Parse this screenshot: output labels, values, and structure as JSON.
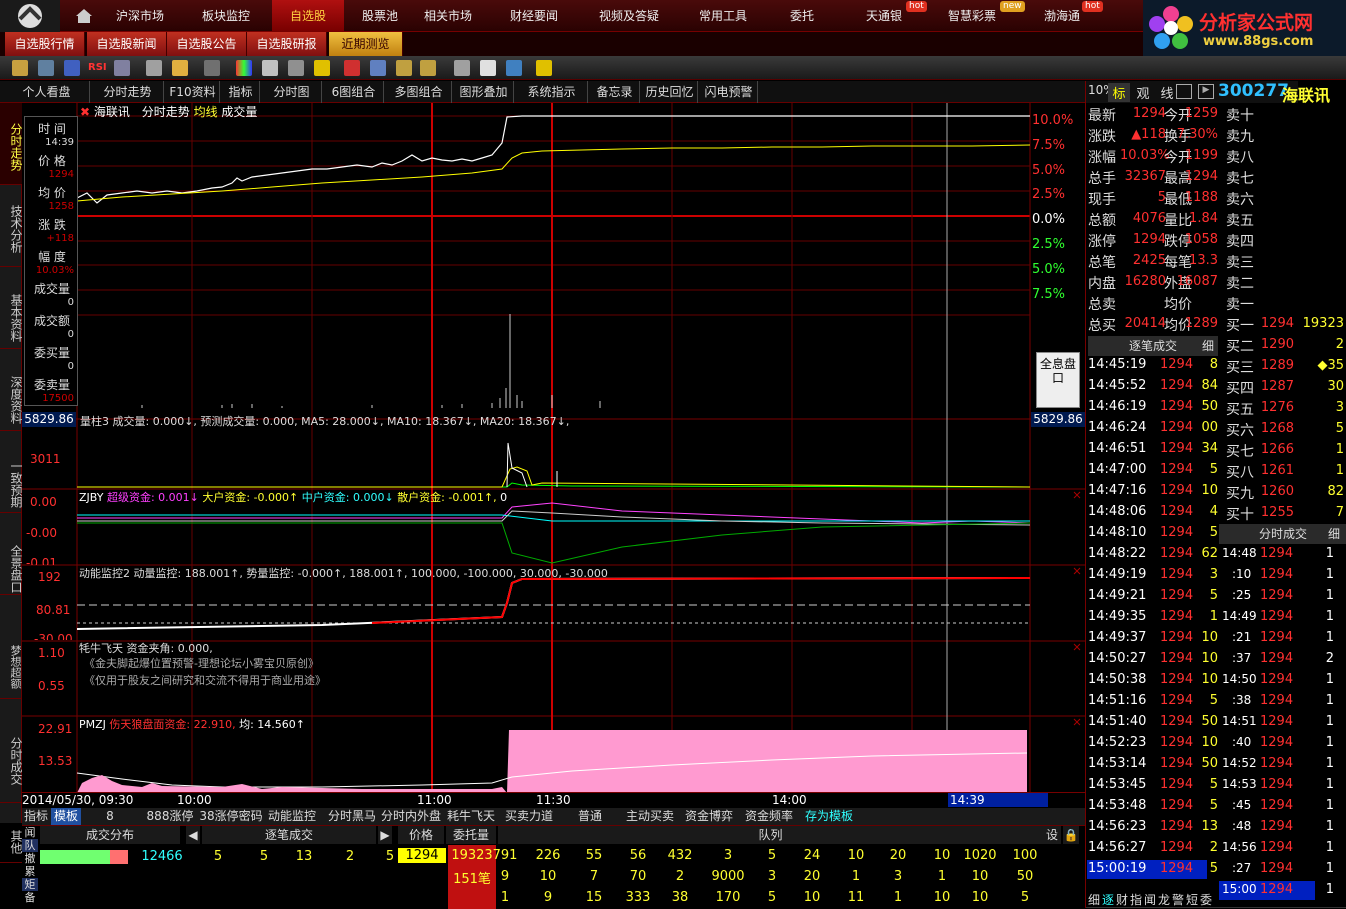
{
  "topnav": {
    "items": [
      "沪深市场",
      "板块监控",
      "自选股",
      "股票池",
      "相关市场",
      "财经要闻",
      "视频及答疑",
      "常用工具",
      "委托",
      "天通银",
      "智慧彩票",
      "渤海通"
    ],
    "badges": [
      "hot",
      "new",
      "hot"
    ]
  },
  "brand": {
    "line1": "分析家公式网",
    "line2": "www.88gs.com"
  },
  "subnav": [
    "自选股行情",
    "自选股新闻",
    "自选股公告",
    "自选股研报",
    "近期测览"
  ],
  "funcbar": [
    "个人看盘",
    "分时走势",
    "F10资料",
    "指标",
    "分时图",
    "6图组合",
    "多图组合",
    "图形叠加",
    "系统指示",
    "备忘录",
    "历史回忆",
    "闪电预警"
  ],
  "leftvtabs": [
    "分时走势",
    "技术分析",
    "基本资料",
    "深度资料",
    "一致预期",
    "全景盘口",
    "梦想超额",
    "分时成交",
    "其他"
  ],
  "chart_header": {
    "stock": "海联讯",
    "mode": "分时走势",
    "avg": "均线",
    "vol": "成交量"
  },
  "infobox": [
    {
      "label": "时 间",
      "value": "14:39"
    },
    {
      "label": "价 格",
      "value": "1294"
    },
    {
      "label": "均 价",
      "value": "1258"
    },
    {
      "label": "涨 跌",
      "value": "+118"
    },
    {
      "label": "幅 度",
      "value": "10.03%"
    },
    {
      "label": "成交量",
      "value": "0"
    },
    {
      "label": "成交额",
      "value": "0"
    },
    {
      "label": "委买量",
      "value": "0"
    },
    {
      "label": "委卖量",
      "value": "17500"
    }
  ],
  "pct_axis": [
    "10.0%",
    "7.5%",
    "5.0%",
    "2.5%",
    "0.0%",
    "2.5%",
    "5.0%",
    "7.5%"
  ],
  "full_info_btn": "全息盘口",
  "vol_panel": {
    "left_val": "5829.86",
    "right_val": "5829.86",
    "legend": "量柱3 成交量: 0.000↓, 预测成交量: 0.000, MA5: 28.000↓, MA10: 18.367↓, MA20: 18.367↓,",
    "ytick": "3011"
  },
  "zjby_panel": {
    "ticks": [
      "0.00",
      "-0.00",
      "-0.01"
    ],
    "legend_name": "ZJBY",
    "items": [
      "超级资金: 0.001↓",
      "大户资金: -0.000↑",
      "中户资金: 0.000↓",
      "散户资金: -0.001↑,",
      "0"
    ]
  },
  "dnjk_panel": {
    "ticks": [
      "192",
      "80.81",
      "-30.00"
    ],
    "legend": "动能监控2 动量监控: 188.001↑, 势量监控: -0.000↑, 188.001↑, 100.000, -100.000, 30.000, -30.000"
  },
  "nfft_panel": {
    "ticks": [
      "1.10",
      "0.55"
    ],
    "legend": "牦牛飞天 资金夹角: 0.000,",
    "line1": "《金夫脚起爆位置预警-理想论坛小雾宝贝原创》",
    "line2": "《仅用于股友之间研究和交流不得用于商业用途》"
  },
  "pmzj_panel": {
    "ticks": [
      "22.91",
      "13.53"
    ],
    "legend_name": "PMZJ",
    "legend_a": "伤天狼盘面资金: 22.910,",
    "legend_b": "均: 14.560↑"
  },
  "xaxis": {
    "date": "2014/05/30, 09:30",
    "ticks": [
      "10:00",
      "11:00",
      "11:30",
      "14:00"
    ],
    "cursor": "14:39"
  },
  "btabs": [
    "指标",
    "模板",
    "8",
    "888涨停",
    "38涨停密码",
    "动能监控",
    "分时黑马",
    "分时内外盘",
    "耗牛飞天",
    "买卖力道",
    "普通",
    "主动买卖",
    "资金博弈",
    "资金频率",
    "存为模板"
  ],
  "bottom": {
    "heads": [
      "成交分布",
      "逐笔成交",
      "价格",
      "委托量",
      "队列",
      "设"
    ],
    "left_tabs": [
      "闻",
      "队",
      "撤",
      "累",
      "矩",
      "备"
    ],
    "total": "12466",
    "zb": [
      "5",
      "5",
      "13",
      "2",
      "5"
    ],
    "price": "1294",
    "wt": "19323",
    "wt2": "151笔",
    "queue": [
      [
        "791",
        "226",
        "55",
        "56",
        "432",
        "3",
        "5",
        "24",
        "10",
        "20",
        "10",
        "1020",
        "100"
      ],
      [
        "9",
        "10",
        "7",
        "70",
        "2",
        "9000",
        "3",
        "20",
        "1",
        "3",
        "1",
        "10",
        "50"
      ],
      [
        "1",
        "9",
        "15",
        "333",
        "38",
        "170",
        "5",
        "10",
        "11",
        "1",
        "10",
        "10",
        "5"
      ]
    ]
  },
  "right": {
    "ratio_tabs": [
      "10%",
      "标",
      "观",
      "线"
    ],
    "code": "300277",
    "name": "海联讯",
    "quote": [
      {
        "l": "最新",
        "v": "1294",
        "l2": "今开",
        "v2": "1259"
      },
      {
        "l": "涨跌",
        "v": "▲118",
        "l2": "换手",
        "v2": "7.30%"
      },
      {
        "l": "涨幅",
        "v": "10.03%",
        "l2": "今开",
        "v2": "1199"
      },
      {
        "l": "总手",
        "v": "32367",
        "l2": "最高",
        "v2": "1294"
      },
      {
        "l": "现手",
        "v": "5",
        "l2": "最低",
        "v2": "1188"
      },
      {
        "l": "总额",
        "v": "4076",
        "l2": "量比",
        "v2": "1.84"
      },
      {
        "l": "涨停",
        "v": "1294",
        "l2": "跌停",
        "v2": "1058"
      },
      {
        "l": "总笔",
        "v": "2425",
        "l2": "每笔",
        "v2": "13.3"
      },
      {
        "l": "内盘",
        "v": "16280",
        "l2": "外盘",
        "v2": "16087"
      },
      {
        "l": "总卖",
        "v": "",
        "l2": "均价",
        "v2": ""
      },
      {
        "l": "总买",
        "v": "20414",
        "l2": "均价",
        "v2": "1289"
      }
    ],
    "sells": [
      "卖十",
      "卖九",
      "卖八",
      "卖七",
      "卖六",
      "卖五",
      "卖四",
      "卖三",
      "卖二",
      "卖一"
    ],
    "buys": [
      {
        "n": "买一",
        "p": "1294",
        "q": "19323"
      },
      {
        "n": "买二",
        "p": "1290",
        "q": "2"
      },
      {
        "n": "买三",
        "p": "1289",
        "q": "◆35"
      },
      {
        "n": "买四",
        "p": "1287",
        "q": "30"
      },
      {
        "n": "买五",
        "p": "1276",
        "q": "3"
      },
      {
        "n": "买六",
        "p": "1268",
        "q": "5"
      },
      {
        "n": "买七",
        "p": "1266",
        "q": "1"
      },
      {
        "n": "买八",
        "p": "1261",
        "q": "1"
      },
      {
        "n": "买九",
        "p": "1260",
        "q": "82"
      },
      {
        "n": "买十",
        "p": "1255",
        "q": "7"
      }
    ],
    "zbcj_title": "逐笔成交",
    "zbcj_detail": "细",
    "ticks": [
      {
        "t": "14:45:19",
        "p": "1294",
        "q": "8"
      },
      {
        "t": "14:45:52",
        "p": "1294",
        "q": "84"
      },
      {
        "t": "14:46:19",
        "p": "1294",
        "q": "50"
      },
      {
        "t": "14:46:24",
        "p": "1294",
        "q": "00"
      },
      {
        "t": "14:46:51",
        "p": "1294",
        "q": "34"
      },
      {
        "t": "14:47:00",
        "p": "1294",
        "q": "5"
      },
      {
        "t": "14:47:16",
        "p": "1294",
        "q": "10"
      },
      {
        "t": "14:48:06",
        "p": "1294",
        "q": "4"
      },
      {
        "t": "14:48:10",
        "p": "1294",
        "q": "5"
      },
      {
        "t": "14:48:22",
        "p": "1294",
        "q": "62"
      },
      {
        "t": "14:49:19",
        "p": "1294",
        "q": "3"
      },
      {
        "t": "14:49:21",
        "p": "1294",
        "q": "5"
      },
      {
        "t": "14:49:35",
        "p": "1294",
        "q": "1"
      },
      {
        "t": "14:49:37",
        "p": "1294",
        "q": "10"
      },
      {
        "t": "14:50:27",
        "p": "1294",
        "q": "10"
      },
      {
        "t": "14:50:38",
        "p": "1294",
        "q": "10"
      },
      {
        "t": "14:51:16",
        "p": "1294",
        "q": "5"
      },
      {
        "t": "14:51:40",
        "p": "1294",
        "q": "50"
      },
      {
        "t": "14:52:23",
        "p": "1294",
        "q": "10"
      },
      {
        "t": "14:53:14",
        "p": "1294",
        "q": "50"
      },
      {
        "t": "14:53:45",
        "p": "1294",
        "q": "5"
      },
      {
        "t": "14:53:48",
        "p": "1294",
        "q": "5"
      },
      {
        "t": "14:56:23",
        "p": "1294",
        "q": "13"
      },
      {
        "t": "14:56:27",
        "p": "1294",
        "q": "2"
      },
      {
        "t": "15:00:19",
        "p": "1294",
        "q": "5"
      }
    ],
    "fscj_title": "分时成交",
    "fscj_detail": "细",
    "fs": [
      {
        "t": "14:48",
        "p": "1294",
        "q": "1"
      },
      {
        "t": ":10",
        "p": "1294",
        "q": "1"
      },
      {
        "t": ":25",
        "p": "1294",
        "q": "1"
      },
      {
        "t": "14:49",
        "p": "1294",
        "q": "1"
      },
      {
        "t": ":21",
        "p": "1294",
        "q": "1"
      },
      {
        "t": ":37",
        "p": "1294",
        "q": "2"
      },
      {
        "t": "14:50",
        "p": "1294",
        "q": "1"
      },
      {
        "t": ":38",
        "p": "1294",
        "q": "1"
      },
      {
        "t": "14:51",
        "p": "1294",
        "q": "1"
      },
      {
        "t": ":40",
        "p": "1294",
        "q": "1"
      },
      {
        "t": "14:52",
        "p": "1294",
        "q": "1"
      },
      {
        "t": "14:53",
        "p": "1294",
        "q": "1"
      },
      {
        "t": ":45",
        "p": "1294",
        "q": "1"
      },
      {
        "t": ":48",
        "p": "1294",
        "q": "1"
      },
      {
        "t": "14:56",
        "p": "1294",
        "q": "1"
      },
      {
        "t": ":27",
        "p": "1294",
        "q": "1"
      },
      {
        "t": "15:00",
        "p": "1294",
        "q": "1"
      }
    ],
    "bottom_tabs": [
      "细",
      "逐",
      "财",
      "指",
      "闻",
      "龙",
      "警",
      "短",
      "委"
    ]
  }
}
